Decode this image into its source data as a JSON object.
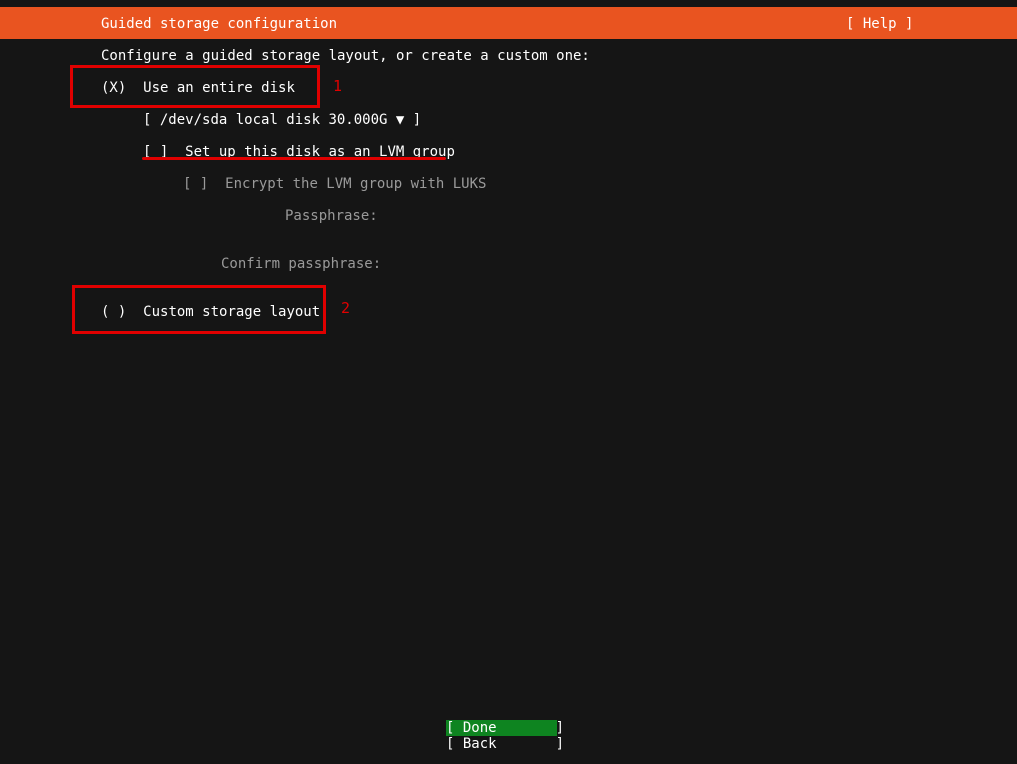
{
  "header": {
    "title": "Guided storage configuration",
    "help_label": "[ Help ]"
  },
  "intro": "Configure a guided storage layout, or create a custom one:",
  "options": {
    "entire_disk": {
      "marker": "(X)",
      "label": "Use an entire disk"
    },
    "disk_select": {
      "open": "[",
      "value": "/dev/sda local disk 30.000G",
      "arrow": "▼",
      "close": "]"
    },
    "lvm": {
      "marker": "[ ]",
      "label": "Set up this disk as an LVM group"
    },
    "encrypt": {
      "marker": "[ ]",
      "label": "Encrypt the LVM group with LUKS"
    },
    "passphrase_label": "Passphrase:",
    "confirm_label": "Confirm passphrase:",
    "custom": {
      "marker": "( )",
      "label": "Custom storage layout"
    }
  },
  "buttons": {
    "done": "[ Done       ]",
    "back": "[ Back       ]"
  },
  "annotations": {
    "first": "1",
    "second": "2"
  },
  "colors": {
    "header_bg": "#e95420",
    "background": "#151515",
    "done_bg": "#0e8420",
    "annotation": "#e00000"
  }
}
